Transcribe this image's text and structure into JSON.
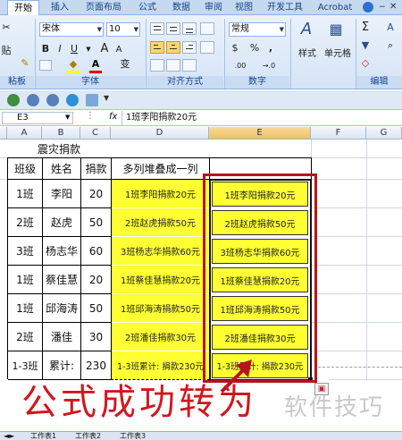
{
  "ribbon": {
    "tabs": [
      "开始",
      "插入",
      "页面布局",
      "公式",
      "数据",
      "审阅",
      "视图",
      "开发工具",
      "Acrobat"
    ],
    "active_tab": "开始",
    "font_name": "宋体",
    "font_size": "10",
    "number_format": "常规",
    "paste_label": "贴",
    "clipboard_label": "粘板",
    "font_group_label": "字体",
    "align_group_label": "对齐方式",
    "number_group_label": "数字",
    "style_label": "样式",
    "cells_label": "单元格",
    "edit_label": "编辑",
    "bold": "B",
    "italic": "I",
    "underline": "U",
    "grow_font": "A",
    "shrink_font": "A",
    "font_color": "A",
    "wen": "变",
    "percent": "%",
    "comma": ",",
    "currency": "$",
    "inc_dec": ".00",
    "dec_dec": "→.0",
    "sigma": "Σ",
    "sort_label": "A",
    "accent_color": "#15428b",
    "ribbon_bg": "#d5e4f6"
  },
  "formula_bar": {
    "cell_ref": "E3",
    "fx": "fx",
    "content": "1班李阳捐款20元"
  },
  "columns": [
    "A",
    "B",
    "C",
    "D",
    "E",
    "F",
    "G"
  ],
  "sheet": {
    "title": "震灾捐款",
    "headers": [
      "班级",
      "姓名",
      "捐款",
      "多列堆叠成一列"
    ],
    "rows": [
      {
        "cls": "1班",
        "name": "李阳",
        "amt": "20",
        "d": "1班李阳捐款20元",
        "e": "1班李阳捐款20元"
      },
      {
        "cls": "2班",
        "name": "赵虎",
        "amt": "50",
        "d": "2班赵虎捐款50元",
        "e": "2班赵虎捐款50元"
      },
      {
        "cls": "3班",
        "name": "杨志华",
        "amt": "60",
        "d": "3班杨志华捐款60元",
        "e": "3班杨志华捐款60元"
      },
      {
        "cls": "1班",
        "name": "蔡佳慧",
        "amt": "20",
        "d": "1班蔡佳慧捐款20元",
        "e": "1班蔡佳慧捐款20元"
      },
      {
        "cls": "1班",
        "name": "邱海涛",
        "amt": "50",
        "d": "1班邱海涛捐款50元",
        "e": "1班邱海涛捐款50元"
      },
      {
        "cls": "2班",
        "name": "潘佳",
        "amt": "30",
        "d": "2班潘佳捐款30元",
        "e": "2班潘佳捐款30元"
      },
      {
        "cls": "1-3班",
        "name": "累计:",
        "amt": "230",
        "d": "1-3班累计: 捐款230元",
        "e": "1-3班累计: 捐款230元"
      }
    ],
    "highlight_color": "#ffff33"
  },
  "sheet_tabs": [
    "工作表1",
    "工作表2",
    "工作表3"
  ],
  "caption": "公式成功转为",
  "watermark": "软件技巧",
  "caption_color": "#d0181f"
}
